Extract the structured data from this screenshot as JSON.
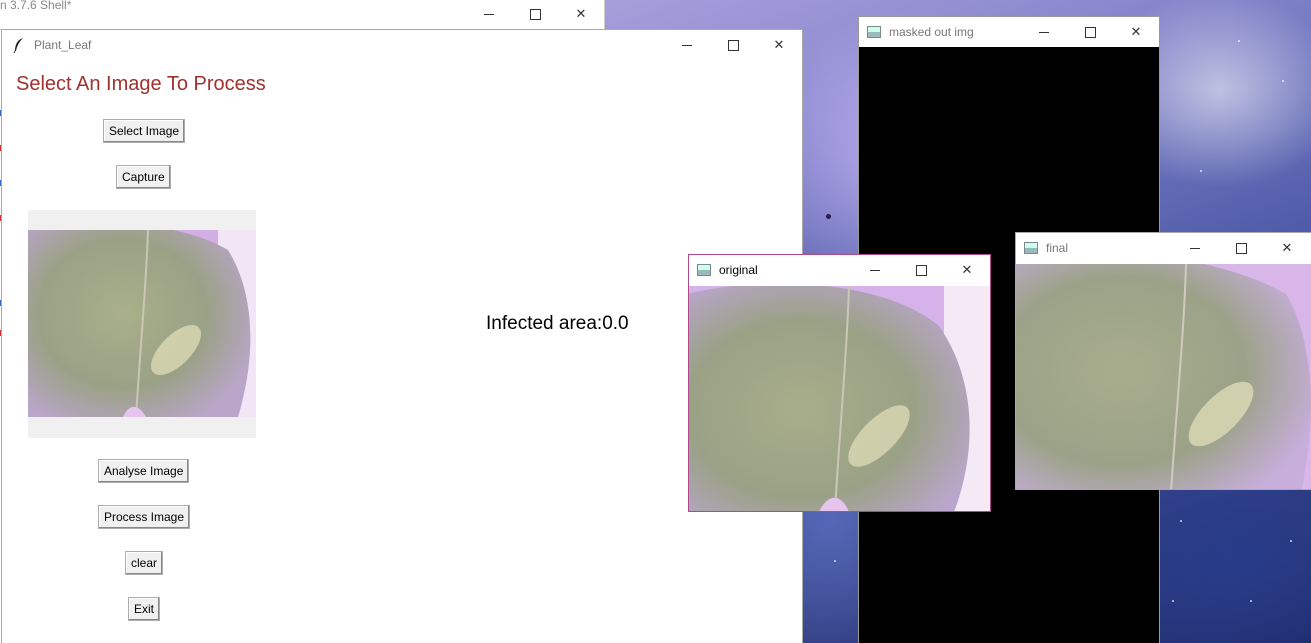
{
  "shell_window": {
    "title": "n 3.7.6 Shell*"
  },
  "plant_window": {
    "title": "Plant_Leaf",
    "heading": "Select An Image To Process",
    "buttons": {
      "select_image": "Select Image",
      "capture": "Capture",
      "analyse_image": "Analyse Image",
      "process_image": "Process Image",
      "clear": "clear",
      "exit": "Exit"
    },
    "infected_area": "Infected area:0.0"
  },
  "masked_window": {
    "title": "masked out img"
  },
  "original_window": {
    "title": "original"
  },
  "final_window": {
    "title": "final"
  },
  "colors": {
    "heading": "#a0312e",
    "original_border": "#b04a8c",
    "mask_bg": "#000000"
  },
  "icons": [
    "feather-icon",
    "minimize-icon",
    "maximize-icon",
    "close-icon",
    "cv-window-icon"
  ]
}
